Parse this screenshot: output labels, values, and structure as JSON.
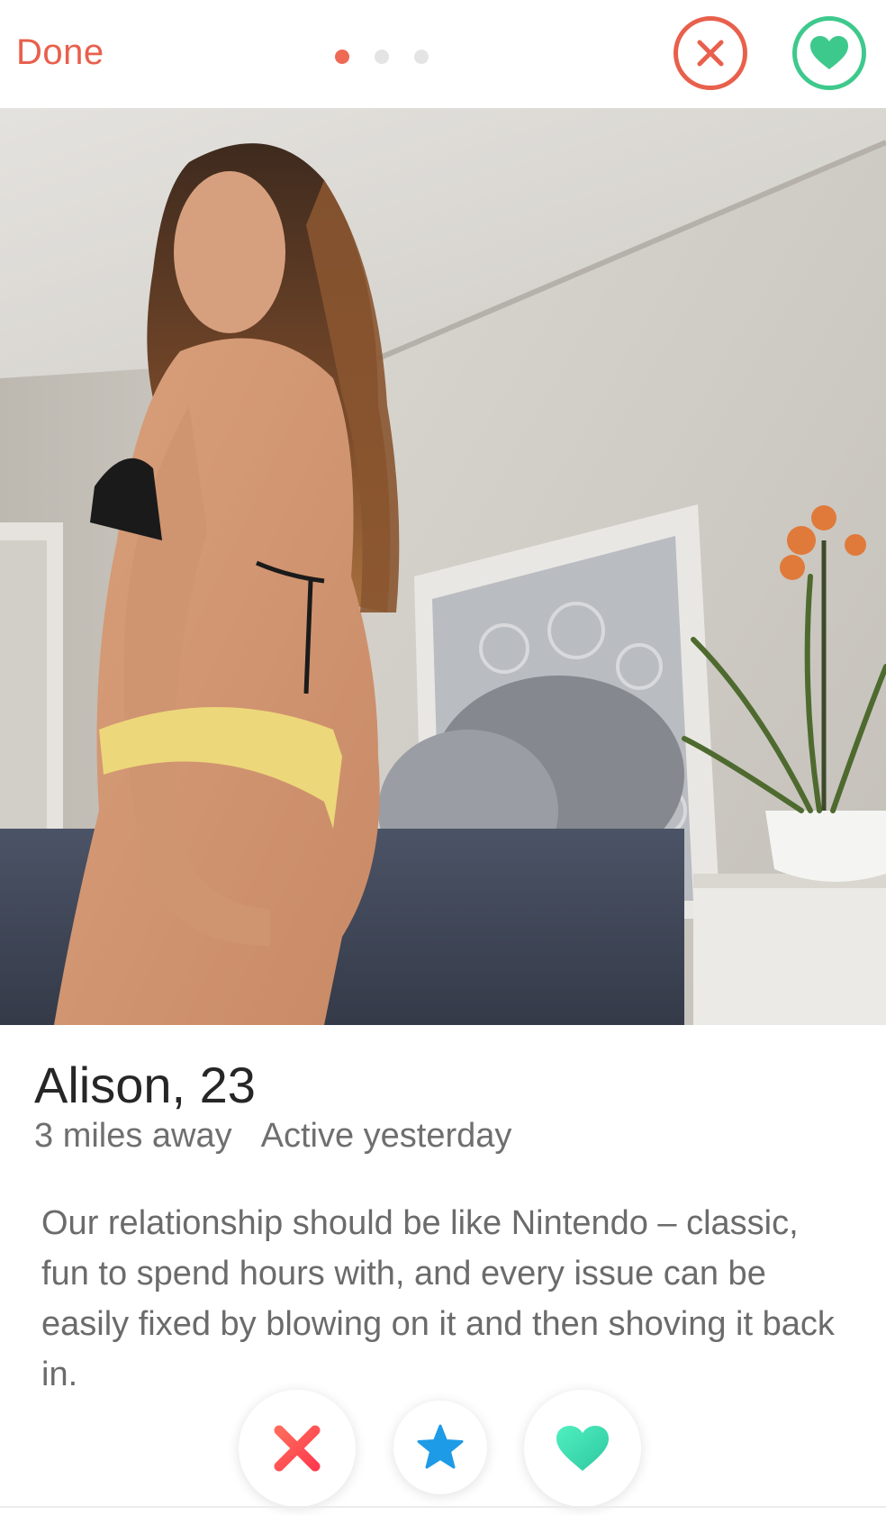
{
  "header": {
    "done_label": "Done",
    "pages_total": 3,
    "page_current": 1,
    "nope_icon": "close-icon",
    "like_icon": "heart-icon"
  },
  "profile": {
    "name_age": "Alison, 23",
    "distance": "3 miles away",
    "activity": "Active yesterday",
    "bio": "Our relationship should be like Nintendo – classic, fun to spend hours with, and every issue can be easily fixed by blowing on it and then shoving it back in."
  },
  "actions": {
    "nope_icon": "x-icon",
    "super_like_icon": "star-icon",
    "like_icon": "heart-icon"
  },
  "colors": {
    "accent_red": "#e8604c",
    "accent_green": "#3ec98c",
    "super_blue": "#1e9be6",
    "like_teal": "#3fe0b0"
  }
}
